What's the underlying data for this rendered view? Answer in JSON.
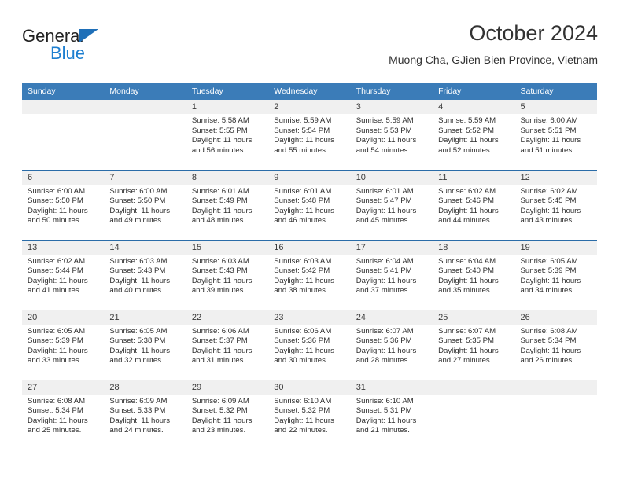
{
  "brand": {
    "name_top": "General",
    "name_bottom": "Blue",
    "triangle_color": "#1e6fb8",
    "blue_text_color": "#1e7fd0"
  },
  "header": {
    "title": "October 2024",
    "subtitle": "Muong Cha, GJien Bien Province, Vietnam"
  },
  "theme": {
    "header_row_bg": "#3b7cb8",
    "row_divider": "#2a6ca8",
    "daynum_bg": "#f0f0f0",
    "text": "#2e2e2e"
  },
  "calendar": {
    "weekday_headers": [
      "Sunday",
      "Monday",
      "Tuesday",
      "Wednesday",
      "Thursday",
      "Friday",
      "Saturday"
    ],
    "labels": {
      "sunrise": "Sunrise:",
      "sunset": "Sunset:",
      "daylight": "Daylight:"
    },
    "weeks": [
      [
        {
          "day": "",
          "sunrise": "",
          "sunset": "",
          "daylight": ""
        },
        {
          "day": "",
          "sunrise": "",
          "sunset": "",
          "daylight": ""
        },
        {
          "day": "1",
          "sunrise": "Sunrise: 5:58 AM",
          "sunset": "Sunset: 5:55 PM",
          "daylight": "Daylight: 11 hours and 56 minutes."
        },
        {
          "day": "2",
          "sunrise": "Sunrise: 5:59 AM",
          "sunset": "Sunset: 5:54 PM",
          "daylight": "Daylight: 11 hours and 55 minutes."
        },
        {
          "day": "3",
          "sunrise": "Sunrise: 5:59 AM",
          "sunset": "Sunset: 5:53 PM",
          "daylight": "Daylight: 11 hours and 54 minutes."
        },
        {
          "day": "4",
          "sunrise": "Sunrise: 5:59 AM",
          "sunset": "Sunset: 5:52 PM",
          "daylight": "Daylight: 11 hours and 52 minutes."
        },
        {
          "day": "5",
          "sunrise": "Sunrise: 6:00 AM",
          "sunset": "Sunset: 5:51 PM",
          "daylight": "Daylight: 11 hours and 51 minutes."
        }
      ],
      [
        {
          "day": "6",
          "sunrise": "Sunrise: 6:00 AM",
          "sunset": "Sunset: 5:50 PM",
          "daylight": "Daylight: 11 hours and 50 minutes."
        },
        {
          "day": "7",
          "sunrise": "Sunrise: 6:00 AM",
          "sunset": "Sunset: 5:50 PM",
          "daylight": "Daylight: 11 hours and 49 minutes."
        },
        {
          "day": "8",
          "sunrise": "Sunrise: 6:01 AM",
          "sunset": "Sunset: 5:49 PM",
          "daylight": "Daylight: 11 hours and 48 minutes."
        },
        {
          "day": "9",
          "sunrise": "Sunrise: 6:01 AM",
          "sunset": "Sunset: 5:48 PM",
          "daylight": "Daylight: 11 hours and 46 minutes."
        },
        {
          "day": "10",
          "sunrise": "Sunrise: 6:01 AM",
          "sunset": "Sunset: 5:47 PM",
          "daylight": "Daylight: 11 hours and 45 minutes."
        },
        {
          "day": "11",
          "sunrise": "Sunrise: 6:02 AM",
          "sunset": "Sunset: 5:46 PM",
          "daylight": "Daylight: 11 hours and 44 minutes."
        },
        {
          "day": "12",
          "sunrise": "Sunrise: 6:02 AM",
          "sunset": "Sunset: 5:45 PM",
          "daylight": "Daylight: 11 hours and 43 minutes."
        }
      ],
      [
        {
          "day": "13",
          "sunrise": "Sunrise: 6:02 AM",
          "sunset": "Sunset: 5:44 PM",
          "daylight": "Daylight: 11 hours and 41 minutes."
        },
        {
          "day": "14",
          "sunrise": "Sunrise: 6:03 AM",
          "sunset": "Sunset: 5:43 PM",
          "daylight": "Daylight: 11 hours and 40 minutes."
        },
        {
          "day": "15",
          "sunrise": "Sunrise: 6:03 AM",
          "sunset": "Sunset: 5:43 PM",
          "daylight": "Daylight: 11 hours and 39 minutes."
        },
        {
          "day": "16",
          "sunrise": "Sunrise: 6:03 AM",
          "sunset": "Sunset: 5:42 PM",
          "daylight": "Daylight: 11 hours and 38 minutes."
        },
        {
          "day": "17",
          "sunrise": "Sunrise: 6:04 AM",
          "sunset": "Sunset: 5:41 PM",
          "daylight": "Daylight: 11 hours and 37 minutes."
        },
        {
          "day": "18",
          "sunrise": "Sunrise: 6:04 AM",
          "sunset": "Sunset: 5:40 PM",
          "daylight": "Daylight: 11 hours and 35 minutes."
        },
        {
          "day": "19",
          "sunrise": "Sunrise: 6:05 AM",
          "sunset": "Sunset: 5:39 PM",
          "daylight": "Daylight: 11 hours and 34 minutes."
        }
      ],
      [
        {
          "day": "20",
          "sunrise": "Sunrise: 6:05 AM",
          "sunset": "Sunset: 5:39 PM",
          "daylight": "Daylight: 11 hours and 33 minutes."
        },
        {
          "day": "21",
          "sunrise": "Sunrise: 6:05 AM",
          "sunset": "Sunset: 5:38 PM",
          "daylight": "Daylight: 11 hours and 32 minutes."
        },
        {
          "day": "22",
          "sunrise": "Sunrise: 6:06 AM",
          "sunset": "Sunset: 5:37 PM",
          "daylight": "Daylight: 11 hours and 31 minutes."
        },
        {
          "day": "23",
          "sunrise": "Sunrise: 6:06 AM",
          "sunset": "Sunset: 5:36 PM",
          "daylight": "Daylight: 11 hours and 30 minutes."
        },
        {
          "day": "24",
          "sunrise": "Sunrise: 6:07 AM",
          "sunset": "Sunset: 5:36 PM",
          "daylight": "Daylight: 11 hours and 28 minutes."
        },
        {
          "day": "25",
          "sunrise": "Sunrise: 6:07 AM",
          "sunset": "Sunset: 5:35 PM",
          "daylight": "Daylight: 11 hours and 27 minutes."
        },
        {
          "day": "26",
          "sunrise": "Sunrise: 6:08 AM",
          "sunset": "Sunset: 5:34 PM",
          "daylight": "Daylight: 11 hours and 26 minutes."
        }
      ],
      [
        {
          "day": "27",
          "sunrise": "Sunrise: 6:08 AM",
          "sunset": "Sunset: 5:34 PM",
          "daylight": "Daylight: 11 hours and 25 minutes."
        },
        {
          "day": "28",
          "sunrise": "Sunrise: 6:09 AM",
          "sunset": "Sunset: 5:33 PM",
          "daylight": "Daylight: 11 hours and 24 minutes."
        },
        {
          "day": "29",
          "sunrise": "Sunrise: 6:09 AM",
          "sunset": "Sunset: 5:32 PM",
          "daylight": "Daylight: 11 hours and 23 minutes."
        },
        {
          "day": "30",
          "sunrise": "Sunrise: 6:10 AM",
          "sunset": "Sunset: 5:32 PM",
          "daylight": "Daylight: 11 hours and 22 minutes."
        },
        {
          "day": "31",
          "sunrise": "Sunrise: 6:10 AM",
          "sunset": "Sunset: 5:31 PM",
          "daylight": "Daylight: 11 hours and 21 minutes."
        },
        {
          "day": "",
          "sunrise": "",
          "sunset": "",
          "daylight": ""
        },
        {
          "day": "",
          "sunrise": "",
          "sunset": "",
          "daylight": ""
        }
      ]
    ]
  }
}
